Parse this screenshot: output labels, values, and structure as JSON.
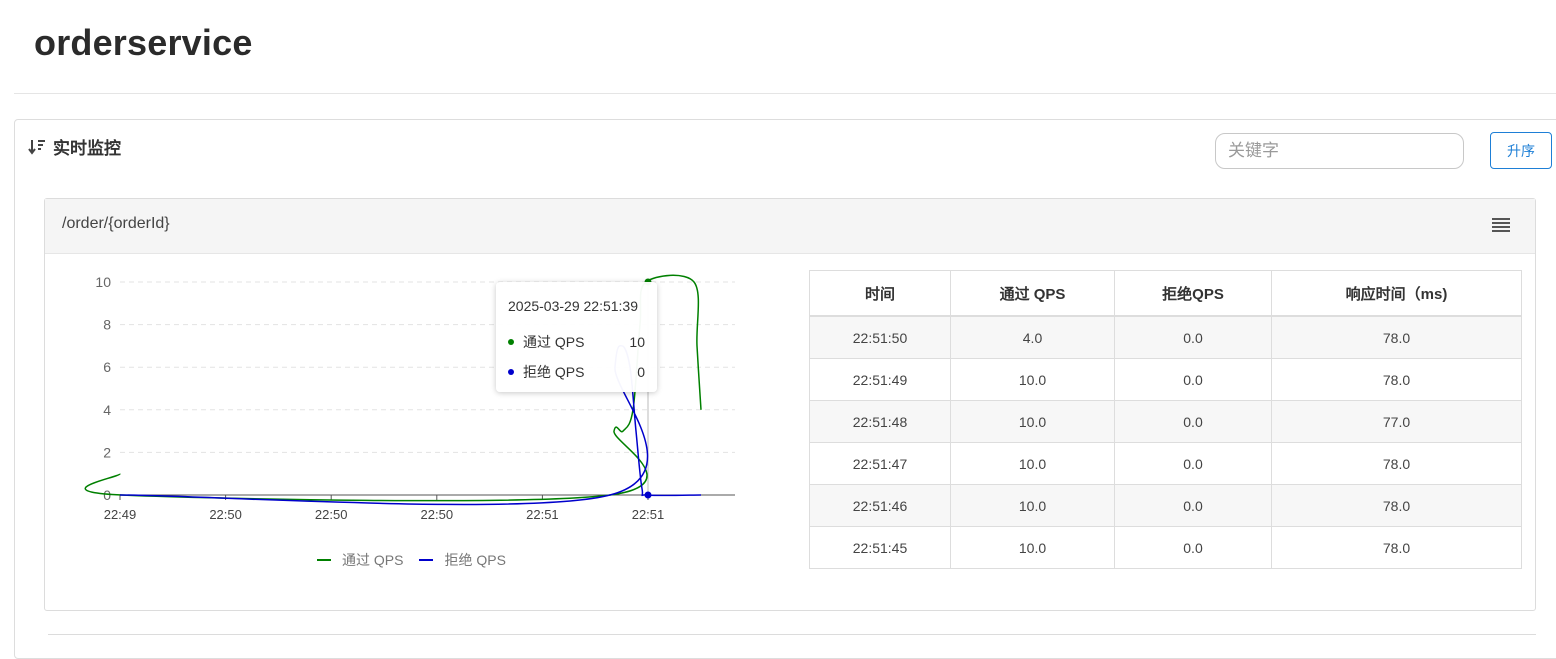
{
  "page": {
    "title": "orderservice"
  },
  "monitor": {
    "header": "实时监控",
    "search": {
      "placeholder": "关键字",
      "value": ""
    },
    "sort_button": "升序"
  },
  "resource": {
    "name": "/order/{orderId}",
    "tooltip": {
      "time": "2025-03-29 22:51:39",
      "rows": [
        {
          "label": "通过 QPS",
          "value": "10",
          "color": "#008000"
        },
        {
          "label": "拒绝 QPS",
          "value": "0",
          "color": "#0000cc"
        }
      ]
    },
    "legend": [
      {
        "label": "通过 QPS",
        "color": "#008000"
      },
      {
        "label": "拒绝 QPS",
        "color": "#0000cc"
      }
    ],
    "table": {
      "headers": [
        "时间",
        "通过 QPS",
        "拒绝QPS",
        "响应时间（ms)"
      ],
      "rows": [
        [
          "22:51:50",
          "4.0",
          "0.0",
          "78.0"
        ],
        [
          "22:51:49",
          "10.0",
          "0.0",
          "78.0"
        ],
        [
          "22:51:48",
          "10.0",
          "0.0",
          "77.0"
        ],
        [
          "22:51:47",
          "10.0",
          "0.0",
          "78.0"
        ],
        [
          "22:51:46",
          "10.0",
          "0.0",
          "78.0"
        ],
        [
          "22:51:45",
          "10.0",
          "0.0",
          "78.0"
        ]
      ]
    }
  },
  "chart_data": {
    "type": "line",
    "title": "",
    "xlabel": "",
    "ylabel": "",
    "x_tick_labels": [
      "22:49",
      "22:50",
      "22:50",
      "22:50",
      "22:51",
      "22:51"
    ],
    "y_ticks": [
      0,
      2,
      4,
      6,
      8,
      10
    ],
    "ylim": [
      0,
      10
    ],
    "grid": true,
    "legend_position": "bottom",
    "series": [
      {
        "name": "通过 QPS",
        "color": "#008000",
        "points": [
          {
            "t": 0,
            "v": 1
          },
          {
            "t": 2,
            "v": 0
          },
          {
            "t": 490,
            "v": 0
          },
          {
            "t": 494,
            "v": 3
          },
          {
            "t": 503,
            "v": 3
          },
          {
            "t": 513,
            "v": 4
          },
          {
            "t": 520,
            "v": 8
          },
          {
            "t": 526,
            "v": 10
          },
          {
            "t": 574,
            "v": 10
          },
          {
            "t": 577,
            "v": 7
          },
          {
            "t": 581,
            "v": 4
          }
        ]
      },
      {
        "name": "拒绝 QPS",
        "color": "#0000cc",
        "points": [
          {
            "t": 0,
            "v": 0
          },
          {
            "t": 490,
            "v": 0
          },
          {
            "t": 495,
            "v": 6
          },
          {
            "t": 502,
            "v": 7
          },
          {
            "t": 510,
            "v": 6
          },
          {
            "t": 516,
            "v": 3
          },
          {
            "t": 522,
            "v": 0.3
          },
          {
            "t": 528,
            "v": 0
          },
          {
            "t": 581,
            "v": 0
          }
        ]
      }
    ],
    "hover": {
      "t": 528,
      "series_values": [
        10,
        0
      ]
    }
  }
}
